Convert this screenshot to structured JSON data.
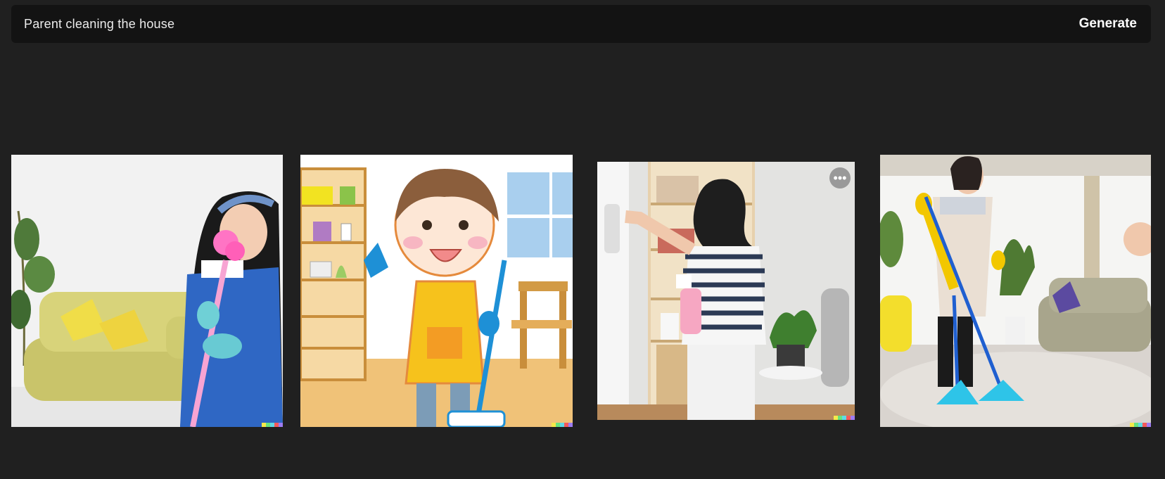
{
  "prompt": {
    "text": "Parent cleaning the house",
    "generate_label": "Generate"
  },
  "images": [
    {
      "icon": "photo-woman-duster-sofa-icon"
    },
    {
      "icon": "cartoon-boy-mop-icon"
    },
    {
      "icon": "photo-woman-spray-bottle-icon",
      "more_label": "•••"
    },
    {
      "icon": "photo-woman-mop-livingroom-icon"
    }
  ],
  "colors": {
    "background": "#202020",
    "prompt_bar": "#131313",
    "signature": [
      "#f5e94a",
      "#67e27d",
      "#5fd9e6",
      "#f25a5a",
      "#9d7cf2"
    ]
  }
}
